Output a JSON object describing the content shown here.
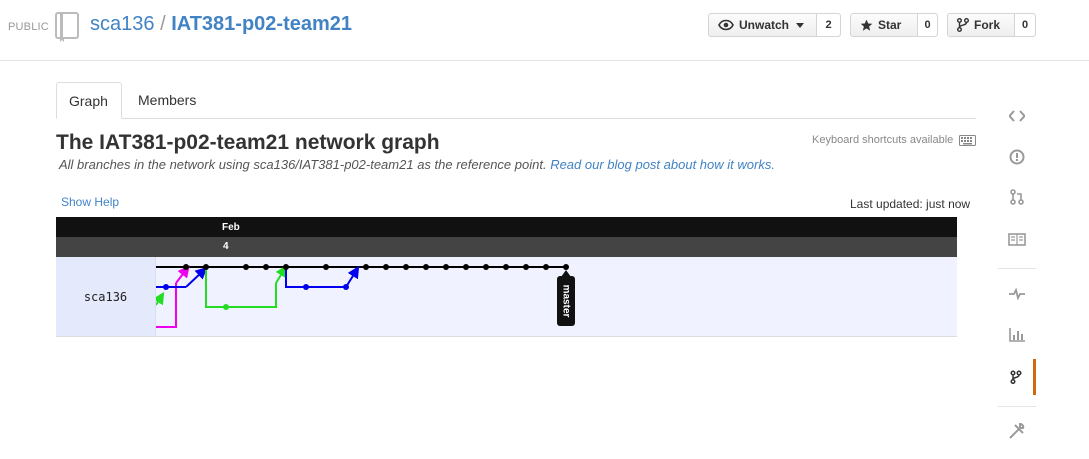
{
  "header": {
    "visibility": "PUBLIC",
    "owner": "sca136",
    "separator": "/",
    "repo": "IAT381-p02-team21",
    "watch": {
      "label": "Unwatch",
      "count": "2"
    },
    "star": {
      "label": "Star",
      "count": "0"
    },
    "fork": {
      "label": "Fork",
      "count": "0"
    }
  },
  "tabs": [
    {
      "label": "Graph",
      "active": true
    },
    {
      "label": "Members",
      "active": false
    }
  ],
  "network": {
    "title": "The IAT381-p02-team21 network graph",
    "subtitle_pre": "All branches in the network using ",
    "subtitle_ref": "sca136/IAT381-p02-team21",
    "subtitle_mid": " as the reference point. ",
    "subtitle_link": "Read our blog post about how it works.",
    "keyboard": "Keyboard shortcuts available",
    "show_help": "Show Help",
    "last_updated": "Last updated: just now",
    "month": "Feb",
    "day": "4",
    "user": "sca136",
    "branch_label": "master"
  },
  "colors": {
    "link": "#4183c4",
    "master_line": "#000000",
    "branch_blue": "#0000ee",
    "branch_green": "#22dd22",
    "branch_magenta": "#ee00ee",
    "active_nav": "#d26911"
  },
  "sidenav": [
    "code-icon",
    "issues-icon",
    "pull-requests-icon",
    "wiki-icon",
    "pulse-icon",
    "graphs-icon",
    "network-icon",
    "settings-icon"
  ]
}
